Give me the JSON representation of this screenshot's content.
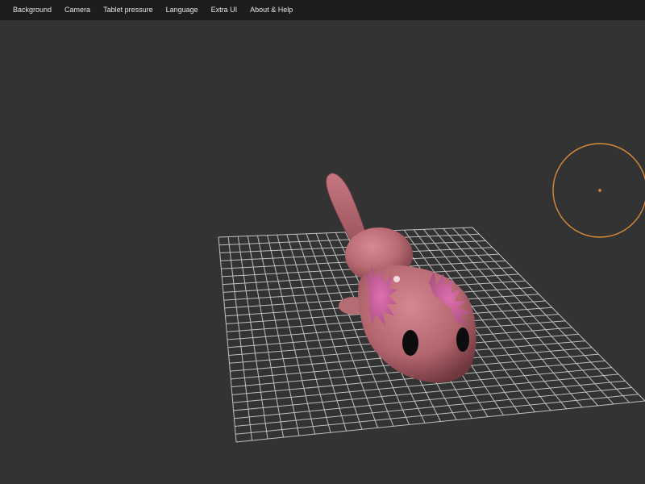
{
  "menubar": {
    "items": [
      {
        "label": "Background"
      },
      {
        "label": "Camera"
      },
      {
        "label": "Tablet pressure"
      },
      {
        "label": "Language"
      },
      {
        "label": "Extra UI"
      },
      {
        "label": "About & Help"
      }
    ]
  },
  "colors": {
    "background": "#333333",
    "menubar": "#1b1d1f",
    "grid": "#c8c8c8",
    "mesh": "#c7777f",
    "brush": "#d98a3a"
  },
  "scene": {
    "model": "axolotl",
    "grid_visible": true
  }
}
